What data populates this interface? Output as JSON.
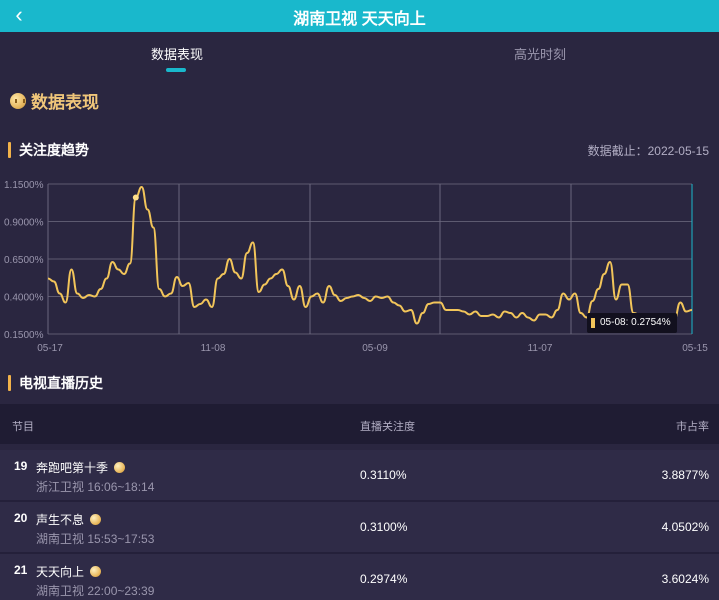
{
  "header": {
    "title": "湖南卫视 天天向上",
    "back_glyph": "‹"
  },
  "tabs": [
    {
      "label": "数据表现",
      "active": true
    },
    {
      "label": "高光时刻",
      "active": false
    }
  ],
  "section": {
    "title": "数据表现"
  },
  "trend": {
    "title": "关注度趋势",
    "cutoff_label": "数据截止：2022-05-15",
    "tooltip": "05-08: 0.2754%"
  },
  "chart_data": {
    "type": "line",
    "y_tick_labels": [
      "1.1500%",
      "0.9000%",
      "0.6500%",
      "0.4000%",
      "0.1500%"
    ],
    "y_ticks": [
      1.15,
      0.9,
      0.65,
      0.4,
      0.15
    ],
    "ylim": [
      0.15,
      1.15
    ],
    "x_tick_labels": [
      "05-17",
      "11-08",
      "05-09",
      "11-07",
      "05-15"
    ],
    "grid": true,
    "series": [
      {
        "color": "#f2c55a",
        "values": [
          0.52,
          0.5,
          0.42,
          0.36,
          0.58,
          0.42,
          0.39,
          0.41,
          0.4,
          0.45,
          0.52,
          0.63,
          0.58,
          0.55,
          0.62,
          1.06,
          1.13,
          0.98,
          0.86,
          0.45,
          0.4,
          0.42,
          0.53,
          0.47,
          0.49,
          0.33,
          0.35,
          0.38,
          0.33,
          0.52,
          0.55,
          0.65,
          0.56,
          0.52,
          0.69,
          0.76,
          0.43,
          0.48,
          0.52,
          0.55,
          0.58,
          0.47,
          0.38,
          0.47,
          0.33,
          0.4,
          0.42,
          0.36,
          0.47,
          0.41,
          0.37,
          0.39,
          0.4,
          0.41,
          0.39,
          0.37,
          0.4,
          0.39,
          0.4,
          0.36,
          0.34,
          0.3,
          0.31,
          0.22,
          0.29,
          0.35,
          0.36,
          0.36,
          0.31,
          0.31,
          0.31,
          0.3,
          0.28,
          0.3,
          0.27,
          0.27,
          0.28,
          0.26,
          0.3,
          0.29,
          0.26,
          0.29,
          0.26,
          0.24,
          0.28,
          0.28,
          0.26,
          0.31,
          0.42,
          0.38,
          0.42,
          0.29,
          0.26,
          0.37,
          0.45,
          0.55,
          0.63,
          0.38,
          0.48,
          0.48,
          0.29,
          0.28,
          0.24,
          0.2,
          0.22,
          0.2,
          0.23,
          0.25,
          0.36,
          0.3,
          0.31
        ]
      }
    ]
  },
  "history": {
    "title": "电视直播历史",
    "columns": [
      "节目",
      "直播关注度",
      "市占率"
    ],
    "rows": [
      {
        "rank": "19",
        "name": "奔跑吧第十季",
        "sub": "浙江卫视 16:06~18:14",
        "attention": "0.3110%",
        "share": "3.8877%"
      },
      {
        "rank": "20",
        "name": "声生不息",
        "sub": "湖南卫视 15:53~17:53",
        "attention": "0.3100%",
        "share": "4.0502%"
      },
      {
        "rank": "21",
        "name": "天天向上",
        "sub": "湖南卫视 22:00~23:39",
        "attention": "0.2974%",
        "share": "3.6024%"
      }
    ]
  }
}
